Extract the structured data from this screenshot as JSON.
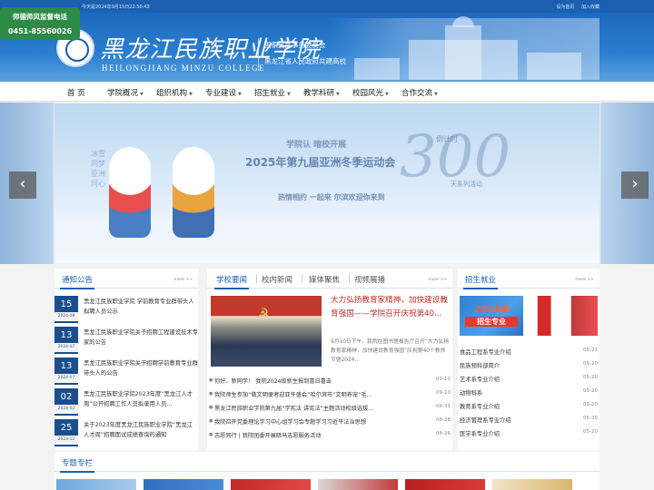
{
  "topbar": {
    "datetime": "今天是2024年9月15日22:50:43",
    "links": [
      "设为首页",
      "加入收藏"
    ]
  },
  "hotline": {
    "label": "师德师风监督电话",
    "phone": "0451-85560026"
  },
  "header": {
    "school_cn": "黑龙江民族职业学院",
    "school_en": "HEILONGJIANG MINZU COLLEGE",
    "partner_line1": "国家民族事务委员会",
    "partner_line2": "黑龙江省人民政府共建高校"
  },
  "nav": {
    "items": [
      "首 页",
      "学院概况",
      "组织机构",
      "专业建设",
      "招生就业",
      "教学科研",
      "校园风光",
      "合作交流"
    ]
  },
  "banner": {
    "line1": "学院认 暗校开展",
    "line2": "2025年第九届亚洲冬季运动会",
    "line3": "热情相约 一起来 尔滨欢迎你来到",
    "countdown": "300",
    "tag": "倒计时",
    "tag2": "天系列活动",
    "slogan": "冰雪同梦 亚洲同心"
  },
  "notices": {
    "title": "通知公告",
    "more": "more >>",
    "items": [
      {
        "day": "15",
        "ym": "2024-08",
        "text": "黑龙江民族职业学院 学前教育专业群带头人拟聘人员公示"
      },
      {
        "day": "13",
        "ym": "2024-07",
        "text": "黑龙江民族职业学院关于招聘工程建设技术专家的公告"
      },
      {
        "day": "13",
        "ym": "2024-07",
        "text": "黑龙江民族职业学院关于招聘学前教育专业群带头人的公告"
      },
      {
        "day": "02",
        "ym": "2024-02",
        "text": "黑龙江民族职业学院2023年度“黑龙江人才周”公开招聘工作人员拟录用人员..."
      },
      {
        "day": "25",
        "ym": "2023-12",
        "text": "关于2023年度黑龙江民族职业学院“黑龙江人才周”招聘面试成绩查询的通知"
      }
    ]
  },
  "news": {
    "tabs": [
      "学校要闻",
      "校内新闻",
      "媒体聚焦",
      "视频展播"
    ],
    "more": "more >>",
    "feature_title": "大力弘扬教育家精神，加快建设教育强国——学院召开庆祝第40...",
    "feature_summary": "9月10日下午，我院在图书馆报告厅召开“大力弘扬教育家精神，加快建设教育强国”庆祝第40个教师节暨2024...",
    "items": [
      {
        "text": "你好，新同学！ 我院2024级新生报到喜日喜击",
        "date": "09-10"
      },
      {
        "text": "我院师生参加“做文明便者迎亚冬盛会”哈尔滨市“文明养宠”毛...",
        "date": "09-10"
      },
      {
        "text": "黑龙江民族职业学院第九届“学宪法 讲宪法”主题活动校级选拔...",
        "date": "08-31"
      },
      {
        "text": "我院召开党委理论学习中心组学习会专题学习习近平法治思想",
        "date": "08-28"
      },
      {
        "text": "志愿同行 | 我院团委开展暗马志愿服务活动",
        "date": "08-26"
      }
    ]
  },
  "recruit": {
    "title": "招生就业",
    "more": "more >>",
    "banner_year": "2024年",
    "banner_label": "招生专业",
    "items": [
      {
        "text": "食品工程系专业介绍",
        "date": "05-21"
      },
      {
        "text": "民族预科部简介",
        "date": "05-20"
      },
      {
        "text": "艺术系专业介绍",
        "date": "05-20"
      },
      {
        "text": "动物科系",
        "date": "05-20"
      },
      {
        "text": "教育系专业介绍",
        "date": "05-20"
      },
      {
        "text": "经济管理系专业介绍",
        "date": "05-20"
      },
      {
        "text": "医学系专业介绍",
        "date": "05-20"
      }
    ]
  },
  "special": {
    "title": "专题专栏"
  },
  "colors": {
    "brand_blue": "#1a5fb0",
    "date_box": "#1a4e8c",
    "feature_red": "#c0302a",
    "hotline_green": "#2e8a47"
  }
}
